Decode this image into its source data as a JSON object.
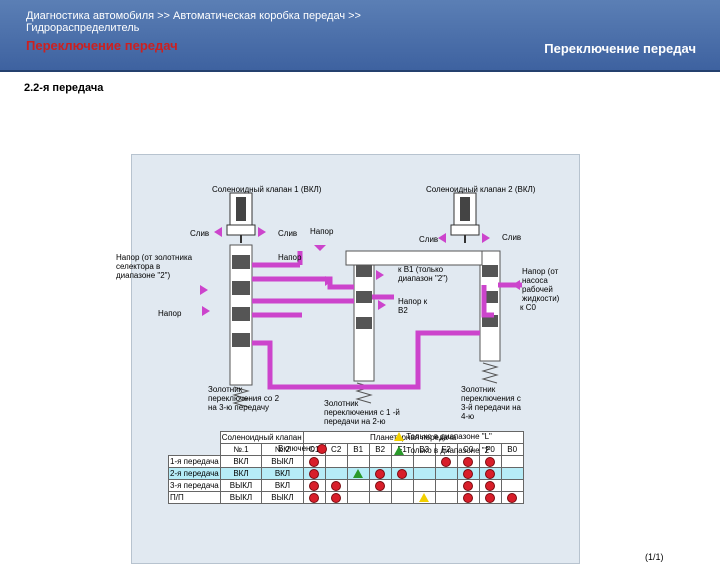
{
  "header": {
    "breadcrumb_line1": "Диагностика автомобиля >> Автоматическая коробка передач >>",
    "breadcrumb_line2": "Гидрораспределитель",
    "title_left": "Переключение передач",
    "title_right": "Переключение передач"
  },
  "section_title": "2.2-я передача",
  "diagram": {
    "solenoid1": "Соленоидный клапан 1 (ВКЛ)",
    "solenoid2": "Соленоидный клапан 2 (ВКЛ)",
    "drain1": "Слив",
    "drain2": "Слив",
    "pressure_top": "Напор",
    "drain3": "Слив",
    "drain4": "Слив",
    "pressure_left1": "Напор (от золотника селектора в диапазоне \"2\")",
    "pressure_mid": "Напор",
    "pressure_left2": "Напор",
    "to_b1": "к В1 (только диапазон \"2\")",
    "pressure_to_b2": "Напор к В2",
    "pump_pressure": "Напор (от насоса рабочей жидкости)",
    "to_c0": "к С0",
    "valve_23": "Золотник переключения со 2 на 3-ю передачу",
    "valve_12": "Золотник переключения с 1 -й передачи на 2-ю",
    "valve_34": "Золотник переключения с 3-й передачи на 4-ю"
  },
  "table": {
    "solenoid_header": "Соленоидный клапан",
    "planetary_header": "Планетарная передача",
    "col_no1": "№.1",
    "col_no2": "№.2",
    "elements": [
      "C1",
      "C2",
      "B1",
      "B2",
      "F1",
      "B3",
      "F2",
      "C0",
      "F0",
      "B0"
    ],
    "rows": [
      {
        "label": "1-я передача",
        "s1": "ВКЛ",
        "s2": "ВЫКЛ",
        "marks": [
          "dot",
          "",
          "",
          "",
          "",
          "",
          "dot",
          "dot",
          "dot",
          ""
        ]
      },
      {
        "label": "2-я передача",
        "s1": "ВКЛ",
        "s2": "ВКЛ",
        "marks": [
          "dot",
          "",
          "g",
          "dot",
          "dot",
          "",
          "",
          "dot",
          "dot",
          ""
        ]
      },
      {
        "label": "3-я передача",
        "s1": "ВЫКЛ",
        "s2": "ВКЛ",
        "marks": [
          "dot",
          "dot",
          "",
          "dot",
          "",
          "",
          "",
          "dot",
          "dot",
          ""
        ]
      },
      {
        "label": "П/П",
        "s1": "ВЫКЛ",
        "s2": "ВЫКЛ",
        "marks": [
          "dot",
          "dot",
          "",
          "",
          "",
          "y",
          "",
          "dot",
          "dot",
          "dot"
        ]
      }
    ],
    "highlight_row": 1
  },
  "legend": {
    "on": "Включено",
    "only_l": "Только в диапазоне \"L\"",
    "only_2": "Только в диапазоне \"2\""
  },
  "page_number": "(1/1)",
  "colors": {
    "header": "#3e62a0",
    "title_red": "#cc2020",
    "fluid": "#cc44cc",
    "panel": "#e1e9f1"
  }
}
